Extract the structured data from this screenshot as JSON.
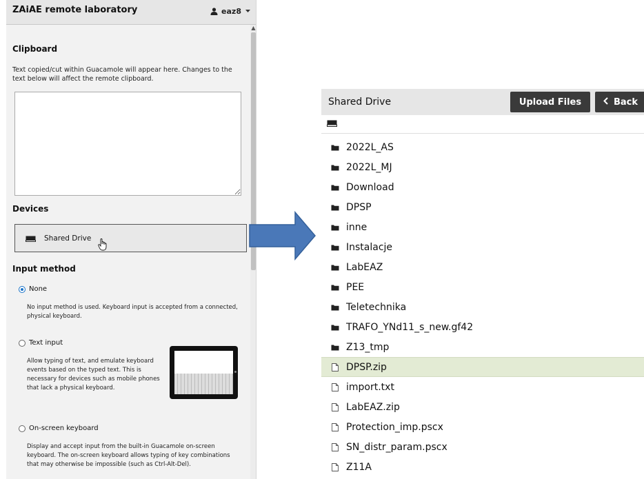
{
  "menu": {
    "title": "ZAiAE remote laboratory",
    "user": "eaz8",
    "user_icon": "user-icon",
    "clipboard": {
      "heading": "Clipboard",
      "description": "Text copied/cut within Guacamole will appear here. Changes to the text below will affect the remote clipboard.",
      "value": ""
    },
    "devices": {
      "heading": "Devices",
      "shared_drive_label": "Shared Drive",
      "icon": "drive-icon"
    },
    "input_method": {
      "heading": "Input method",
      "options": [
        {
          "label": "None",
          "selected": true,
          "description": "No input method is used. Keyboard input is accepted from a connected, physical keyboard."
        },
        {
          "label": "Text input",
          "selected": false,
          "description": "Allow typing of text, and emulate keyboard events based on the typed text. This is necessary for devices such as mobile phones that lack a physical keyboard."
        },
        {
          "label": "On-screen keyboard",
          "selected": false,
          "description": "Display and accept input from the built-in Guacamole on-screen keyboard. The on-screen keyboard allows typing of key combinations that may otherwise be impossible (such as Ctrl-Alt-Del)."
        }
      ]
    }
  },
  "drive": {
    "title": "Shared Drive",
    "upload_label": "Upload Files",
    "back_label": "Back",
    "path_icon": "drive-icon",
    "items": [
      {
        "name": "2022L_AS",
        "type": "folder"
      },
      {
        "name": "2022L_MJ",
        "type": "folder"
      },
      {
        "name": "Download",
        "type": "folder"
      },
      {
        "name": "DPSP",
        "type": "folder"
      },
      {
        "name": "inne",
        "type": "folder"
      },
      {
        "name": "Instalacje",
        "type": "folder"
      },
      {
        "name": "LabEAZ",
        "type": "folder"
      },
      {
        "name": "PEE",
        "type": "folder"
      },
      {
        "name": "Teletechnika",
        "type": "folder"
      },
      {
        "name": "TRAFO_YNd11_s_new.gf42",
        "type": "folder"
      },
      {
        "name": "Z13_tmp",
        "type": "folder"
      },
      {
        "name": "DPSP.zip",
        "type": "file",
        "selected": true
      },
      {
        "name": "import.txt",
        "type": "file"
      },
      {
        "name": "LabEAZ.zip",
        "type": "file"
      },
      {
        "name": "Protection_imp.pscx",
        "type": "file"
      },
      {
        "name": "SN_distr_param.pscx",
        "type": "file"
      },
      {
        "name": "Z11A",
        "type": "file"
      }
    ]
  },
  "colors": {
    "arrow": "#4a78b8",
    "selected_row": "#e3ebd4",
    "button_dark": "#3a3a3a",
    "radio_accent": "#1a73c8"
  }
}
